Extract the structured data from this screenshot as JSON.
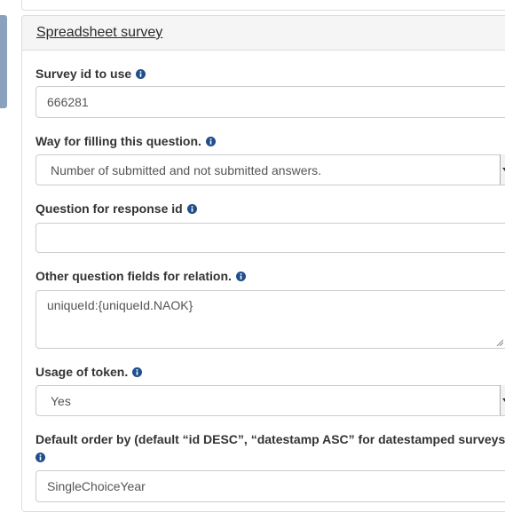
{
  "panel": {
    "title": "Spreadsheet survey"
  },
  "fields": {
    "survey_id": {
      "label": "Survey id to use",
      "value": "666281"
    },
    "filling_way": {
      "label": "Way for filling this question.",
      "selected": "Number of submitted and not submitted answers."
    },
    "response_question": {
      "label": "Question for response id",
      "value": ""
    },
    "other_fields": {
      "label": "Other question fields for relation.",
      "value": "uniqueId:{uniqueId.NAOK}"
    },
    "token_usage": {
      "label": "Usage of token.",
      "selected": "Yes"
    },
    "default_order": {
      "label": "Default order by (default “id DESC”, “datestamp ASC” for datestamped surveys",
      "value": "SingleChoiceYear"
    }
  },
  "icons": {
    "info": "info-circle-icon",
    "info_color": "#1f4e8c"
  }
}
